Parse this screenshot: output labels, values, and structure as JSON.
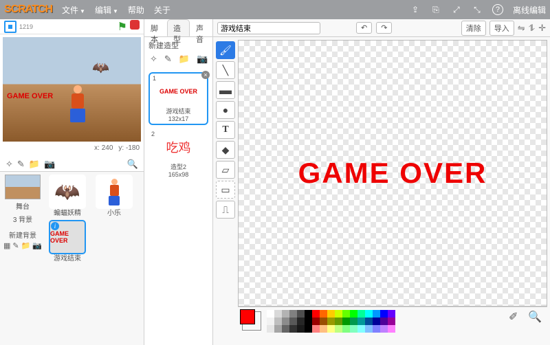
{
  "app": {
    "logo": "SCRATCH",
    "offline": "离线编辑"
  },
  "menu": {
    "file": "文件",
    "edit": "编辑",
    "help": "帮助",
    "about": "关于"
  },
  "stage": {
    "count": "1219",
    "x_label": "x:",
    "x_val": "240",
    "y_label": "y:",
    "y_val": "-180",
    "game_over": "GAME OVER"
  },
  "backdrop": {
    "title": "舞台",
    "count": "3 背景",
    "new": "新建背景"
  },
  "sprites": {
    "items": [
      {
        "name": "蝙蝠妖精"
      },
      {
        "name": "小乐"
      },
      {
        "name": "游戏结束",
        "caption": "GAME OVER"
      }
    ]
  },
  "tabs": {
    "scripts": "脚本",
    "costumes": "造型",
    "sounds": "声音"
  },
  "costumes": {
    "new": "新建造型",
    "items": [
      {
        "num": "1",
        "label": "GAME OVER",
        "name": "游戏结束",
        "size": "132x17"
      },
      {
        "num": "2",
        "label": "吃鸡",
        "name": "造型2",
        "size": "165x98"
      }
    ]
  },
  "paint": {
    "name_value": "游戏结束",
    "clear": "清除",
    "import": "导入",
    "canvas_text": "GAME OVER"
  },
  "icons": {
    "brush": "🖌",
    "line": "╲",
    "rect": "▭",
    "circle": "●",
    "text": "T",
    "fill": "◆",
    "erase": "◯",
    "sel": "⬚",
    "stamp": "⎍",
    "undo": "↶",
    "redo": "↷",
    "flip_h": "⇋",
    "flip_v": "⥮",
    "center": "✛",
    "share": "⇪",
    "dup": "⎘",
    "expand": "⤢",
    "shrink": "⤡",
    "help": "?",
    "cam": "📷",
    "folder": "📁",
    "paint": "✎",
    "pick": "✐"
  },
  "palette": [
    "#ffffff",
    "#d9d9d9",
    "#b3b3b3",
    "#808080",
    "#4d4d4d",
    "#000000",
    "#ff0000",
    "#ff6600",
    "#ffcc00",
    "#ccff00",
    "#66ff00",
    "#00ff00",
    "#00ff99",
    "#00ffff",
    "#0099ff",
    "#0000ff",
    "#6600ff",
    "#f2f2f2",
    "#bfbfbf",
    "#8c8c8c",
    "#595959",
    "#262626",
    "#000000",
    "#990000",
    "#994d00",
    "#999900",
    "#669900",
    "#009900",
    "#00994d",
    "#009999",
    "#004d99",
    "#000099",
    "#4d0099",
    "#990099",
    "#e6e6e6",
    "#a6a6a6",
    "#666666",
    "#333333",
    "#1a1a1a",
    "#000000",
    "#ff8080",
    "#ffbf80",
    "#ffff80",
    "#bfff80",
    "#80ff80",
    "#80ffbf",
    "#80ffff",
    "#80bfff",
    "#8080ff",
    "#bf80ff",
    "#ff80ff"
  ]
}
